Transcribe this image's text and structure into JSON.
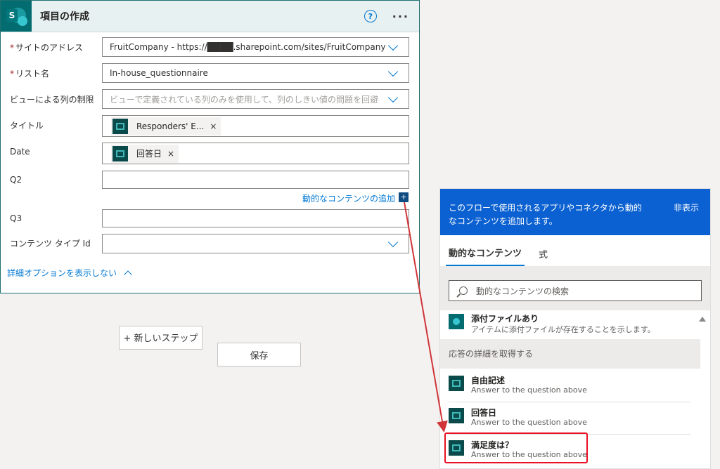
{
  "card": {
    "title": "項目の作成",
    "help": "?",
    "more": "···",
    "fields": {
      "site_label": "サイトのアドレス",
      "site_value": "FruitCompany - https://████.sharepoint.com/sites/FruitCompany",
      "list_label": "リスト名",
      "list_value": "In-house_questionnaire",
      "view_label": "ビューによる列の制限",
      "view_placeholder": "ビューで定義されている列のみを使用して、列のしきい値の問題を回避",
      "title_label": "タイトル",
      "title_token": "Responders' E...",
      "date_label": "Date",
      "date_token": "回答日",
      "q2_label": "Q2",
      "q3_label": "Q3",
      "content_type_label": "コンテンツ タイプ Id"
    },
    "required_mark": "*",
    "token_remove": "×",
    "dynamic_link": "動的なコンテンツの追加",
    "dynamic_plus": "+",
    "advanced_link": "詳細オプションを表示しない"
  },
  "buttons": {
    "new_step": "+ 新しいステップ",
    "save": "保存"
  },
  "panel": {
    "header_text": "このフローで使用されるアプリやコネクタから動的なコンテンツを追加します。",
    "hide": "非表示",
    "tabs": [
      "動的なコンテンツ",
      "式"
    ],
    "search_placeholder": "動的なコンテンツの検索",
    "items": [
      {
        "title": "添付ファイルあり",
        "desc": "アイテムに添付ファイルが存在することを示します。",
        "icon": "sharepoint-icon"
      },
      {
        "title": "自由記述",
        "desc": "Answer to the question above",
        "icon": "forms-icon"
      },
      {
        "title": "回答日",
        "desc": "Answer to the question above",
        "icon": "forms-icon"
      },
      {
        "title": "満足度は？",
        "desc": "Answer to the question above",
        "icon": "forms-icon"
      }
    ],
    "section_title": "応答の詳細を取得する"
  },
  "colors": {
    "accent": "#0078d4",
    "panel_header": "#0b61d1",
    "highlight": "#e81123",
    "arrow": "#d13438"
  }
}
